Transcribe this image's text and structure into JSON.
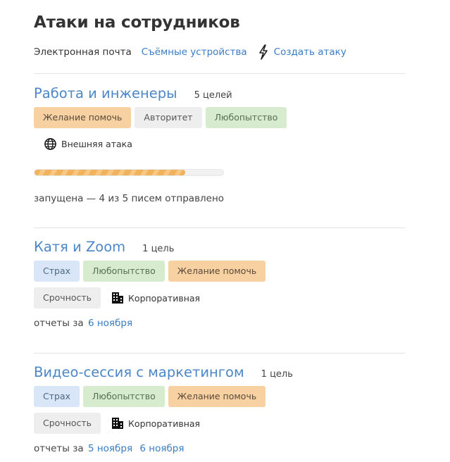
{
  "page": {
    "title": "Атаки на сотрудников"
  },
  "nav": {
    "email": "Электронная почта",
    "removable": "Съёмные устройства",
    "create": "Создать атаку"
  },
  "icons": {
    "bolt": "lightning-icon",
    "globe": "globe-icon",
    "building": "building-icon"
  },
  "colors": {
    "link": "#3a7cc4",
    "tag_orange": "#f8d1a3",
    "tag_green": "#d7ebcf",
    "tag_blue": "#d9e6f7",
    "tag_gray": "#eeeeee",
    "progress": "#f0b25a"
  },
  "attacks": [
    {
      "title": "Работа и инженеры",
      "count": "5 целей",
      "tags": [
        "Желание помочь",
        "Авторитет",
        "Любопытство"
      ],
      "source": "Внешняя атака",
      "progress": 0.8,
      "status": "запущена — 4 из 5 писем отправлено"
    },
    {
      "title": "Катя и Zoom",
      "count": "1 цель",
      "tags": [
        "Страх",
        "Любопытство",
        "Желание помочь",
        "Срочность"
      ],
      "source": "Корпоративная",
      "reports_label": "отчеты за",
      "reports": [
        "6 ноября"
      ]
    },
    {
      "title": "Видео-сессия с маркетингом",
      "count": "1 цель",
      "tags": [
        "Страх",
        "Любопытство",
        "Желание помочь",
        "Срочность"
      ],
      "source": "Корпоративная",
      "reports_label": "отчеты за",
      "reports": [
        "5 ноября",
        "6 ноября"
      ]
    }
  ]
}
